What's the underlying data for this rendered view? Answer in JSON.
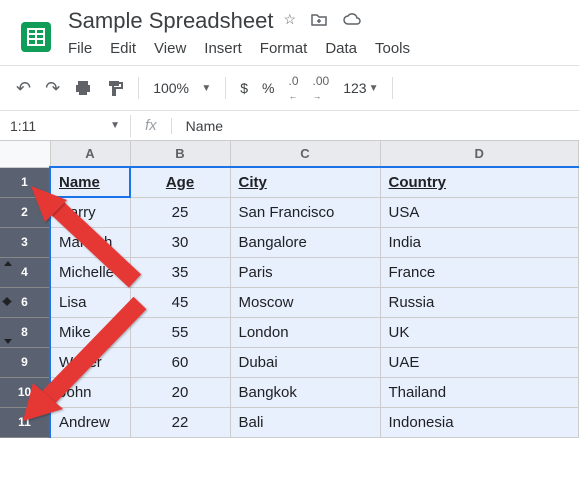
{
  "doc": {
    "title": "Sample Spreadsheet"
  },
  "menu": {
    "file": "File",
    "edit": "Edit",
    "view": "View",
    "insert": "Insert",
    "format": "Format",
    "data": "Data",
    "tools": "Tools"
  },
  "toolbar": {
    "zoom": "100%",
    "currency": "$",
    "percent": "%",
    "dec_dec": ".0",
    "dec_inc": ".00",
    "num_fmt": "123"
  },
  "formula": {
    "name_box": "1:11",
    "fx": "fx",
    "value": "Name"
  },
  "columns": [
    "A",
    "B",
    "C",
    "D"
  ],
  "row_numbers": [
    "1",
    "2",
    "3",
    "4",
    "6",
    "8",
    "9",
    "10",
    "11"
  ],
  "headers": {
    "name": "Name",
    "age": "Age",
    "city": "City",
    "country": "Country"
  },
  "rows": [
    {
      "name": "Harry",
      "age": "25",
      "city": "San Francisco",
      "country": "USA"
    },
    {
      "name": "Mahesh",
      "age": "30",
      "city": "Bangalore",
      "country": "India"
    },
    {
      "name": "Michelle",
      "age": "35",
      "city": "Paris",
      "country": "France"
    },
    {
      "name": "Lisa",
      "age": "45",
      "city": "Moscow",
      "country": "Russia"
    },
    {
      "name": "Mike",
      "age": "55",
      "city": "London",
      "country": "UK"
    },
    {
      "name": "Walter",
      "age": "60",
      "city": "Dubai",
      "country": "UAE"
    },
    {
      "name": "John",
      "age": "20",
      "city": "Bangkok",
      "country": "Thailand"
    },
    {
      "name": "Andrew",
      "age": "22",
      "city": "Bali",
      "country": "Indonesia"
    }
  ]
}
